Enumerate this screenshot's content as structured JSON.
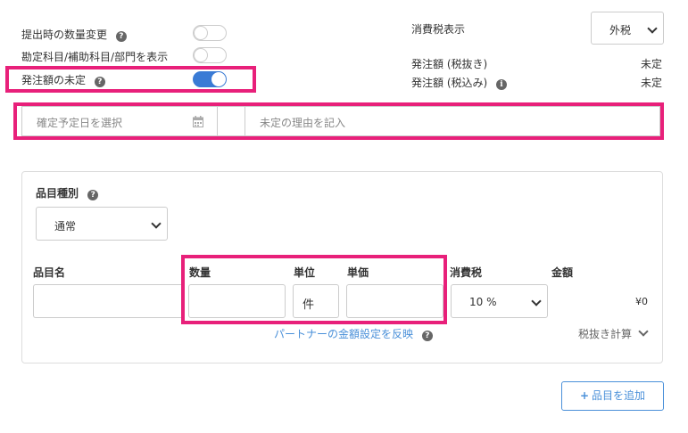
{
  "settings": {
    "qty_change_label": "提出時の数量変更",
    "account_display_label": "勘定科目/補助科目/部門を表示",
    "amount_undecided_label": "発注額の未定"
  },
  "tax": {
    "display_label": "消費税表示",
    "display_value": "外税",
    "amount_excl_label": "発注額 (税抜き)",
    "amount_excl_value": "未定",
    "amount_incl_label": "発注額 (税込み)",
    "amount_incl_value": "未定"
  },
  "undecided": {
    "date_placeholder": "確定予定日を選択",
    "reason_placeholder": "未定の理由を記入"
  },
  "item": {
    "type_label": "品目種別",
    "type_value": "通常",
    "name_header": "品目名",
    "qty_header": "数量",
    "unit_header": "単位",
    "unit_value": "件",
    "price_header": "単価",
    "tax_header": "消費税",
    "tax_value": "10 %",
    "amount_header": "金額",
    "amount_value": "¥0",
    "partner_link": "パートナーの金額設定を反映",
    "tax_calc_label": "税抜き計算",
    "add_button": "品目を追加"
  }
}
